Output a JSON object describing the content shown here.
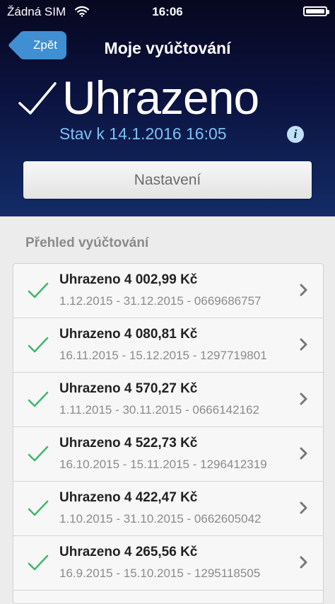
{
  "status_bar": {
    "carrier": "Žádná SIM",
    "time": "16:06"
  },
  "nav": {
    "back_label": "Zpět",
    "title": "Moje vyúčtování"
  },
  "status": {
    "title": "Uhrazeno",
    "date": "Stav k 14.1.2016 16:05"
  },
  "settings_label": "Nastavení",
  "overview": {
    "title": "Přehled vyúčtování",
    "items": [
      {
        "amount": "Uhrazeno 4 002,99 Kč",
        "period": "1.12.2015 - 31.12.2015 - 0669686757"
      },
      {
        "amount": "Uhrazeno 4 080,81 Kč",
        "period": "16.11.2015 - 15.12.2015 - 1297719801"
      },
      {
        "amount": "Uhrazeno 4 570,27 Kč",
        "period": "1.11.2015 - 30.11.2015 - 0666142162"
      },
      {
        "amount": "Uhrazeno 4 522,73 Kč",
        "period": "16.10.2015 - 15.11.2015 - 1296412319"
      },
      {
        "amount": "Uhrazeno 4 422,47 Kč",
        "period": "1.10.2015 - 31.10.2015 - 0662605042"
      },
      {
        "amount": "Uhrazeno 4 265,56 Kč",
        "period": "16.9.2015 - 15.10.2015 - 1295118505"
      }
    ]
  },
  "colors": {
    "accent_blue": "#3f8fd2",
    "check_green": "#3cb86a",
    "date_blue": "#7dc1f3"
  }
}
